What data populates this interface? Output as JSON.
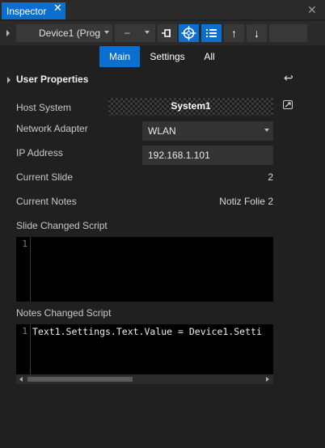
{
  "window": {
    "tab_title": "Inspector",
    "tab_close": "✕",
    "close": "✕"
  },
  "toolbar": {
    "device_select": "Device1 (Prog",
    "dash_select": "–",
    "pin_icon": "⊸",
    "target_icon": "⌖",
    "list_icon": "≣",
    "up_icon": "↑",
    "down_icon": "↓"
  },
  "tabs": [
    {
      "label": "Main",
      "selected": true
    },
    {
      "label": "Settings",
      "selected": false
    },
    {
      "label": "All",
      "selected": false
    }
  ],
  "section": {
    "title": "User Properties",
    "return_icon": "↩"
  },
  "properties": {
    "host_system": {
      "label": "Host System",
      "value": "System1"
    },
    "network_adapter": {
      "label": "Network Adapter",
      "value": "WLAN"
    },
    "ip_address": {
      "label": "IP Address",
      "value": "192.168.1.101"
    },
    "current_slide": {
      "label": "Current Slide",
      "value": "2"
    },
    "current_notes": {
      "label": "Current Notes",
      "value": "Notiz Folie 2"
    }
  },
  "slide_script": {
    "label": "Slide Changed Script",
    "line_number": "1",
    "code": ""
  },
  "notes_script": {
    "label": "Notes Changed Script",
    "line_number": "1",
    "code": "Text1.Settings.Text.Value = Device1.Setti"
  },
  "colors": {
    "accent": "#0a6fcf",
    "background": "#202020",
    "code_bg": "#000000"
  }
}
